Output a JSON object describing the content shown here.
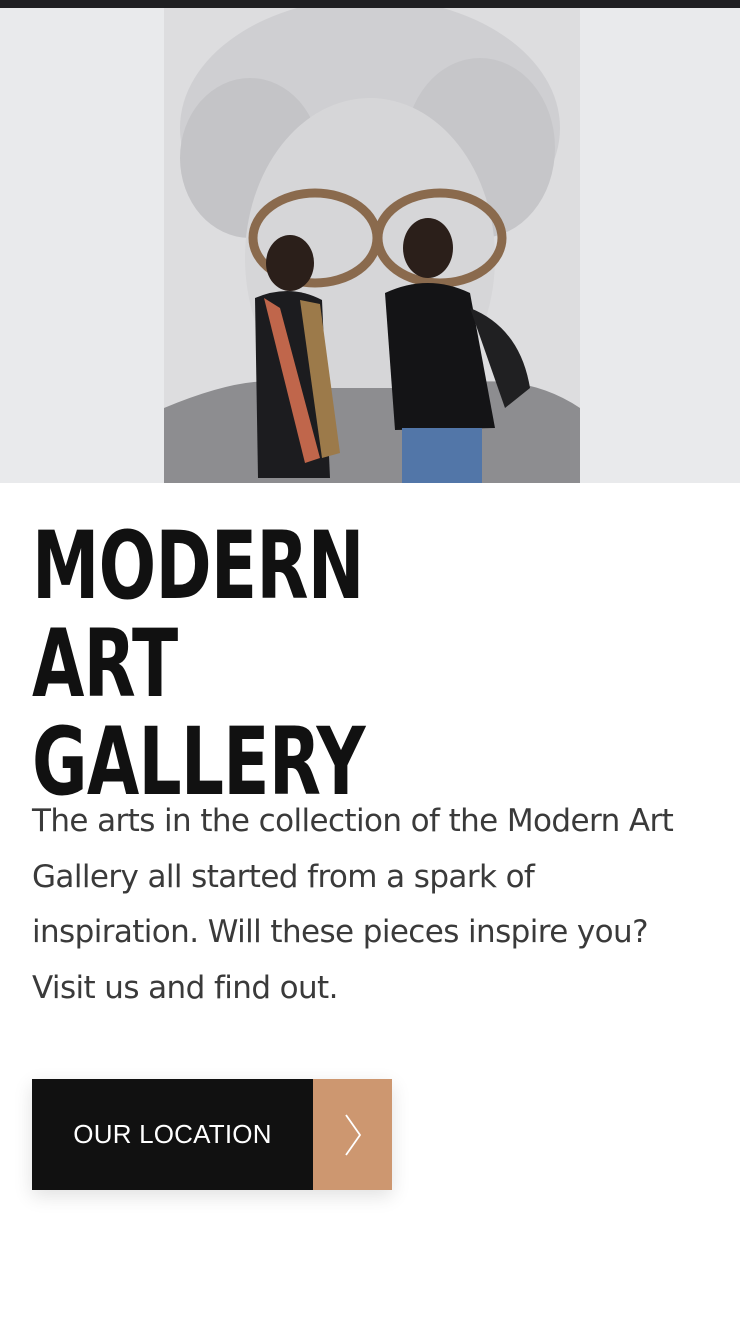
{
  "hero": {
    "image_alt": "Two visitors viewing a large pencil portrait of an elderly woman with glasses"
  },
  "title": "MODERN ART\nGALLERY",
  "description": "The arts in the collection of the Modern Art Gallery all started from a spark of inspiration. Will these pieces inspire you? Visit us and find out.",
  "cta": {
    "label": "OUR LOCATION",
    "icon": "chevron-right-icon"
  },
  "colors": {
    "top_bar": "#1f1f22",
    "title": "#111111",
    "text": "#3a3a3a",
    "button_dark": "#111111",
    "button_accent": "#cd9770"
  }
}
